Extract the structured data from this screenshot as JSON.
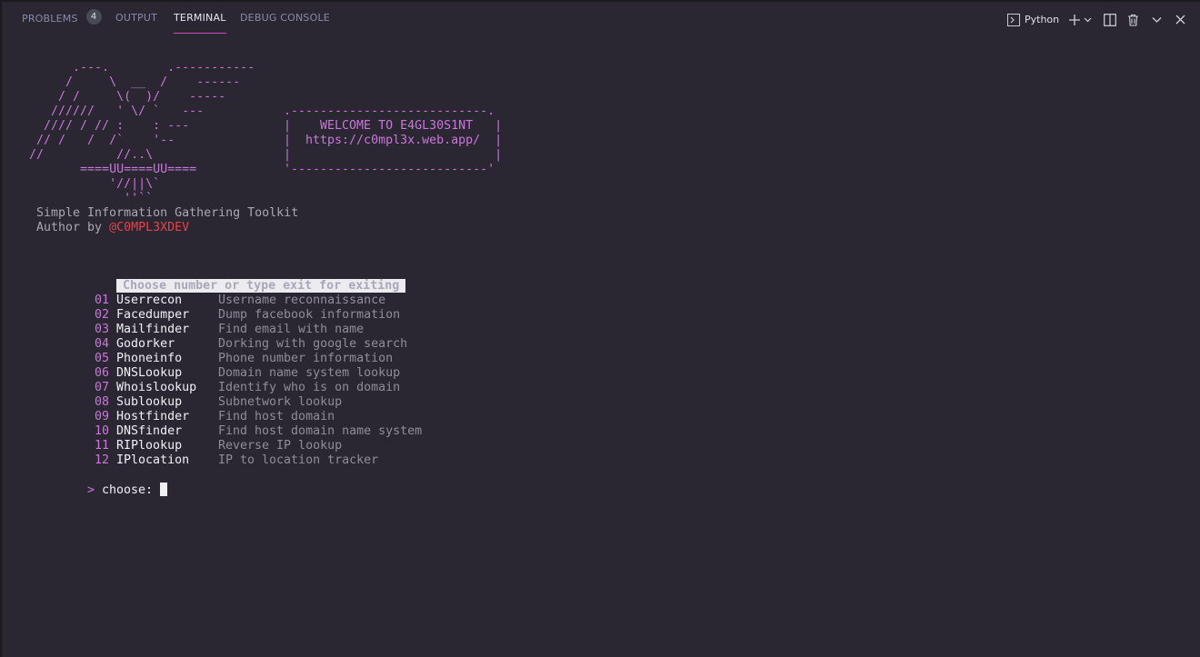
{
  "panel": {
    "tabs": [
      {
        "label": "PROBLEMS",
        "badge": "4"
      },
      {
        "label": "OUTPUT"
      },
      {
        "label": "TERMINAL",
        "active": true
      },
      {
        "label": "DEBUG CONSOLE"
      }
    ],
    "actions": {
      "shell_label": "Python",
      "shell_icon": "terminal-icon",
      "new_icon": "plus-icon",
      "dropdown_icon": "chevron-down-icon",
      "split_icon": "split-icon",
      "kill_icon": "trash-icon",
      "maximize_icon": "chevron-down-icon",
      "close_icon": "close-icon"
    },
    "accent_color": "#c84fb9"
  },
  "terminal": {
    "ascii_art": [
      "       .---.        .-----------",
      "      /     \\  __  /    ------",
      "     / /     \\(  )/    -----",
      "    //////   ' \\/ `   ---",
      "   //// / // :    : ---",
      "  // /   /  /`    '--",
      " //          //..\\",
      "        ====UU====UU====",
      "            '//||\\`",
      "              ''``"
    ],
    "welcome_box": [
      ".---------------------------.",
      "|    WELCOME TO E4GL30S1NT   |",
      "|  https://c0mpl3x.web.app/  |",
      "|                            |",
      "'---------------------------'"
    ],
    "subtitle": "Simple Information Gathering Toolkit",
    "author_prefix": "Author by ",
    "author_handle": "@C0MPL3XDEV",
    "menu_header": "Choose number or type exit for exiting",
    "menu": [
      {
        "num": "01",
        "name": "Userrecon",
        "desc": "Username reconnaissance"
      },
      {
        "num": "02",
        "name": "Facedumper",
        "desc": "Dump facebook information"
      },
      {
        "num": "03",
        "name": "Mailfinder",
        "desc": "Find email with name"
      },
      {
        "num": "04",
        "name": "Godorker",
        "desc": "Dorking with google search"
      },
      {
        "num": "05",
        "name": "Phoneinfo",
        "desc": "Phone number information"
      },
      {
        "num": "06",
        "name": "DNSLookup",
        "desc": "Domain name system lookup"
      },
      {
        "num": "07",
        "name": "Whoislookup",
        "desc": "Identify who is on domain"
      },
      {
        "num": "08",
        "name": "Sublookup",
        "desc": "Subnetwork lookup"
      },
      {
        "num": "09",
        "name": "Hostfinder",
        "desc": "Find host domain"
      },
      {
        "num": "10",
        "name": "DNSfinder",
        "desc": "Find host domain name system"
      },
      {
        "num": "11",
        "name": "RIPlookup",
        "desc": "Reverse IP lookup"
      },
      {
        "num": "12",
        "name": "IPlocation",
        "desc": "IP to location tracker"
      }
    ],
    "prompt_symbol": ">",
    "prompt_label": " choose: "
  }
}
